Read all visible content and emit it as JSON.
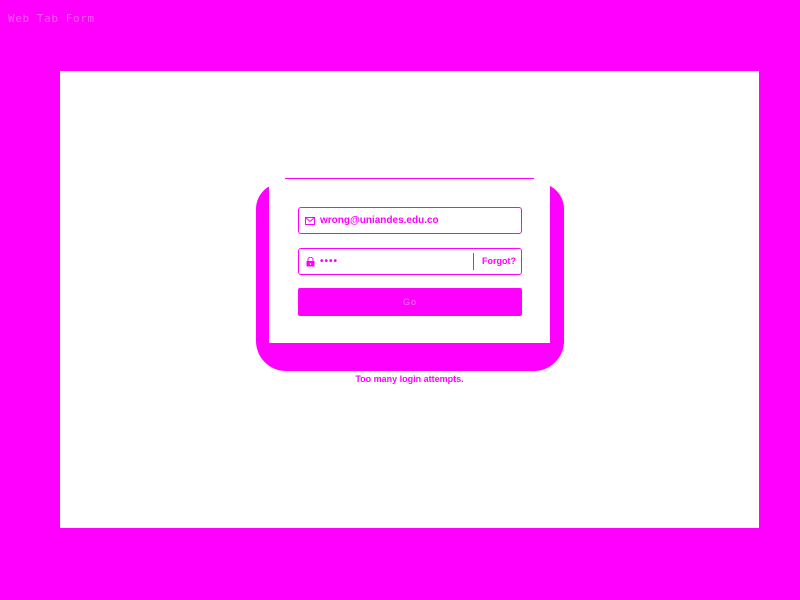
{
  "window": {
    "title": "Web Tab Form"
  },
  "login": {
    "email_value": "wrong@uniandes.edu.co",
    "password_value": "••••",
    "forgot_label": "Forgot?",
    "submit_label": "Go",
    "error_message": "Too many login attempts."
  },
  "icons": {
    "email": "mail-icon",
    "password": "lock-icon"
  },
  "colors": {
    "background": "#FF00FF",
    "canvas": "#FFFFFF",
    "accent": "#FF00FF"
  }
}
